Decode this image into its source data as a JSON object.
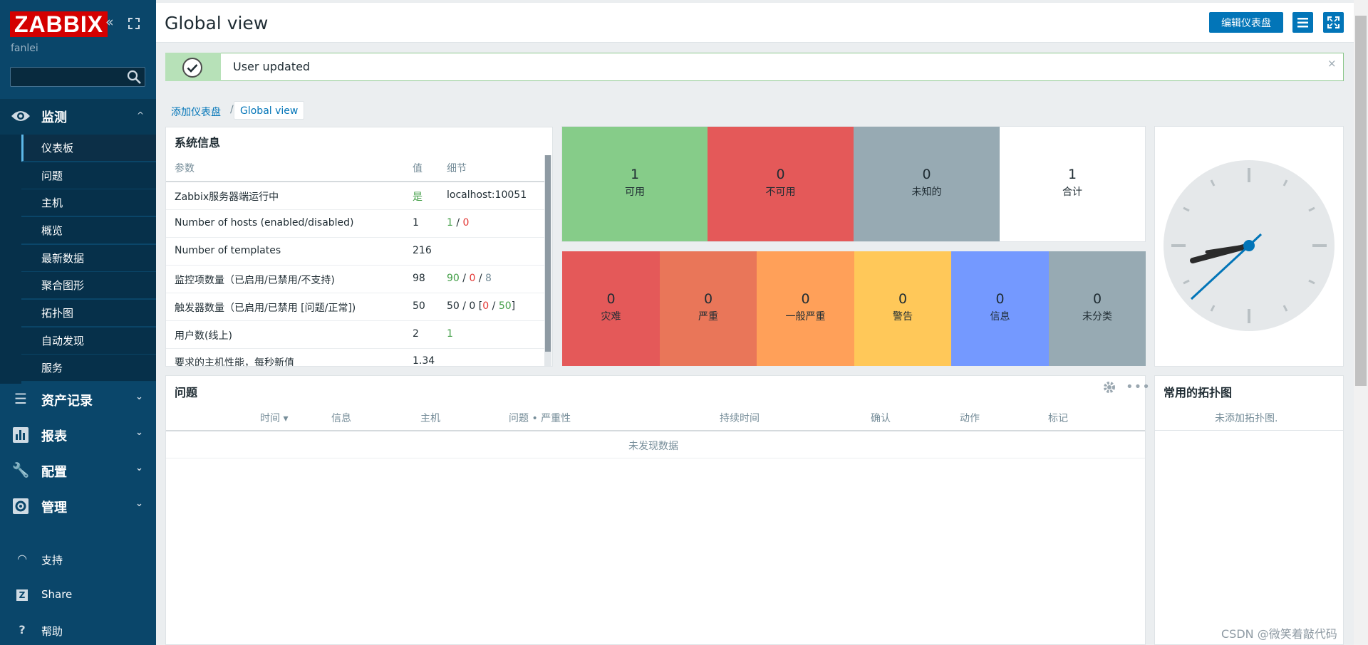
{
  "sidebar": {
    "logo": "ZABBIX",
    "user": "fanlei",
    "search_placeholder": "",
    "monitoring": {
      "label": "监测",
      "items": [
        "仪表板",
        "问题",
        "主机",
        "概览",
        "最新数据",
        "聚合图形",
        "拓扑图",
        "自动发现",
        "服务"
      ]
    },
    "menus": [
      {
        "label": "资产记录",
        "icon": "list-icon"
      },
      {
        "label": "报表",
        "icon": "chart-icon"
      },
      {
        "label": "配置",
        "icon": "wrench-icon"
      },
      {
        "label": "管理",
        "icon": "gear-icon"
      }
    ],
    "bottom": [
      {
        "label": "支持",
        "icon": "headset-icon"
      },
      {
        "label": "Share",
        "icon": "share-icon"
      },
      {
        "label": "帮助",
        "icon": "help-icon"
      }
    ]
  },
  "header": {
    "title": "Global view",
    "edit_button": "编辑仪表盘"
  },
  "message": {
    "text": "User updated",
    "close": "×"
  },
  "breadcrumb": {
    "parent": "添加仪表盘",
    "separator": "/",
    "current": "Global view"
  },
  "system_info": {
    "title": "系统信息",
    "headers": [
      "参数",
      "值",
      "细节"
    ],
    "rows": [
      {
        "param": "Zabbix服务器端运行中",
        "value": "是",
        "detail": "localhost:10051"
      },
      {
        "param": "Number of hosts (enabled/disabled)",
        "value": "1",
        "d1": "1",
        "d2": "0"
      },
      {
        "param": "Number of templates",
        "value": "216"
      },
      {
        "param": "监控项数量（已启用/已禁用/不支持)",
        "value": "98",
        "d1": "90",
        "d2": "0",
        "d3": "8"
      },
      {
        "param": "触发器数量（已启用/已禁用 [问题/正常])",
        "value": "50",
        "d0": "50 / 0 [",
        "d1": "0",
        "d2": "50",
        "d3": "]"
      },
      {
        "param": "用户数(线上)",
        "value": "2",
        "d1": "1"
      },
      {
        "param": "要求的主机性能，每秒新值",
        "value": "1.34"
      }
    ]
  },
  "host_availability": [
    {
      "count": "1",
      "label": "可用",
      "color": "#86cc89"
    },
    {
      "count": "0",
      "label": "不可用",
      "color": "#e45959"
    },
    {
      "count": "0",
      "label": "未知的",
      "color": "#97aab3"
    },
    {
      "count": "1",
      "label": "合计",
      "color": "#ffffff"
    }
  ],
  "severity": [
    {
      "count": "0",
      "label": "灾难",
      "color": "#e45959"
    },
    {
      "count": "0",
      "label": "严重",
      "color": "#e97659"
    },
    {
      "count": "0",
      "label": "一般严重",
      "color": "#ffa059"
    },
    {
      "count": "0",
      "label": "警告",
      "color": "#ffc859"
    },
    {
      "count": "0",
      "label": "信息",
      "color": "#7499ff"
    },
    {
      "count": "0",
      "label": "未分类",
      "color": "#97aab3"
    }
  ],
  "problems": {
    "title": "问题",
    "headers": [
      "时间 ▾",
      "信息",
      "主机",
      "问题 • 严重性",
      "持续时间",
      "确认",
      "动作",
      "标记"
    ],
    "empty": "未发现数据"
  },
  "maps": {
    "title": "常用的拓扑图",
    "empty": "未添加拓扑图."
  },
  "watermark": "CSDN @微笑着敲代码"
}
